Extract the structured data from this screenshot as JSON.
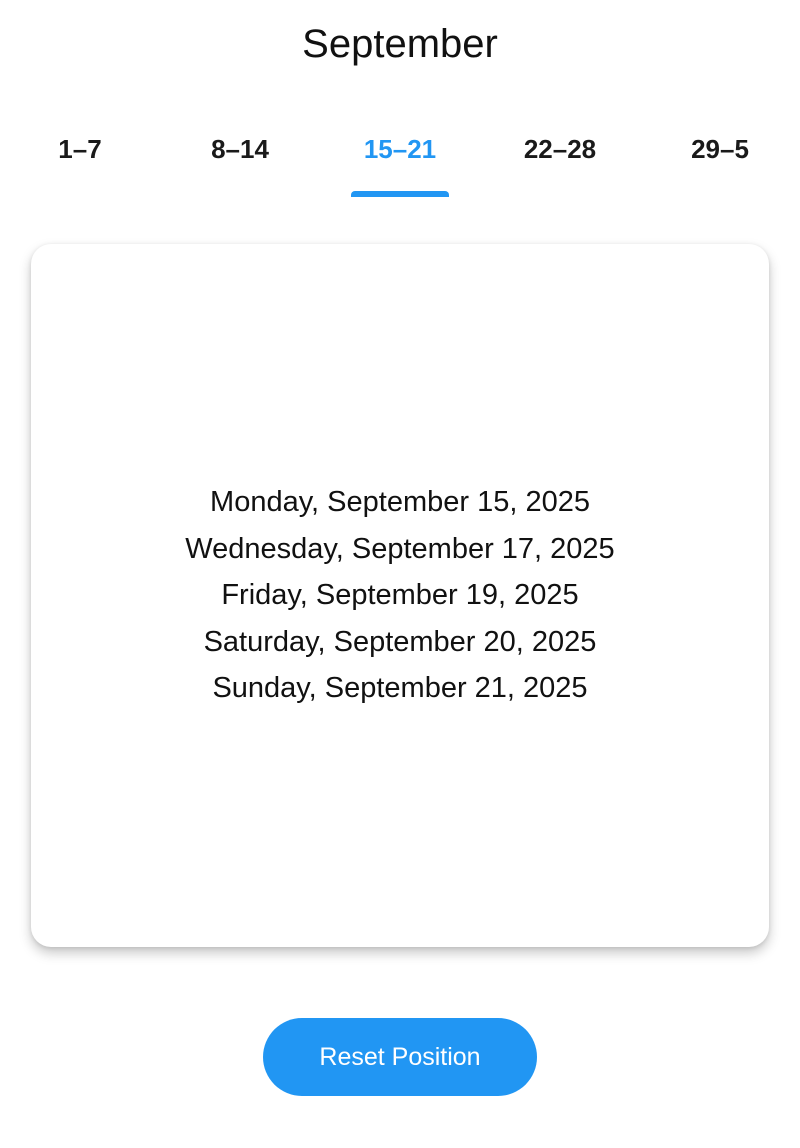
{
  "header": {
    "title": "September"
  },
  "tabs": [
    {
      "label": "1–7",
      "active": false
    },
    {
      "label": "8–14",
      "active": false
    },
    {
      "label": "15–21",
      "active": true
    },
    {
      "label": "22–28",
      "active": false
    },
    {
      "label": "29–5",
      "active": false
    }
  ],
  "card": {
    "dates": [
      "Monday, September 15, 2025",
      "Wednesday, September 17, 2025",
      "Friday, September 19, 2025",
      "Saturday, September 20, 2025",
      "Sunday, September 21, 2025"
    ]
  },
  "actions": {
    "reset_label": "Reset Position"
  },
  "colors": {
    "accent": "#2196f3",
    "text": "#111111",
    "background": "#ffffff"
  }
}
